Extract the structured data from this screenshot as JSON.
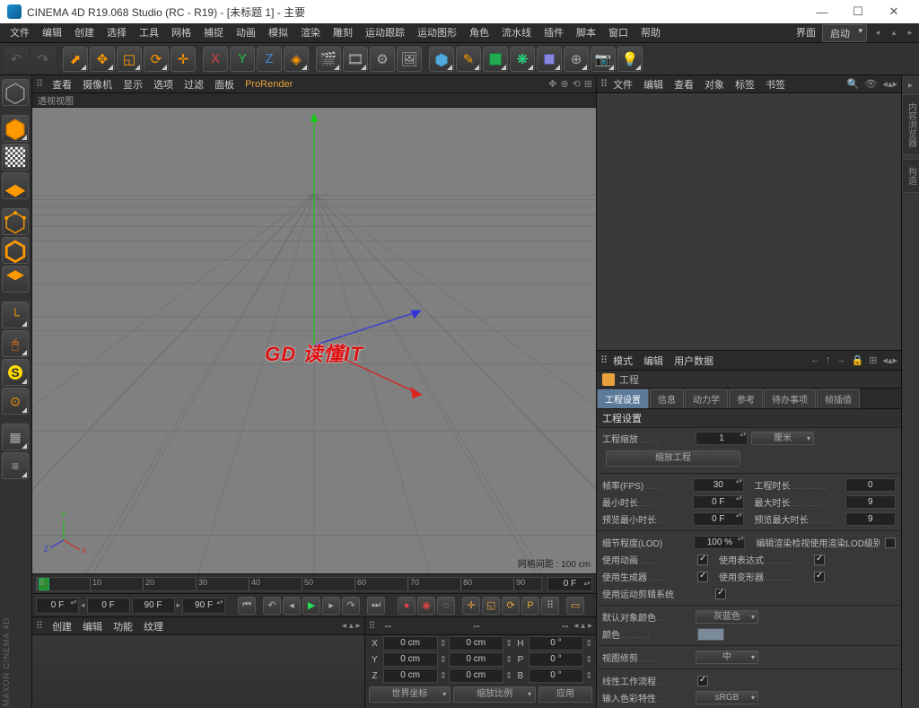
{
  "title": "CINEMA 4D R19.068 Studio (RC - R19) - [未标题 1] - 主要",
  "mainmenu": [
    "文件",
    "编辑",
    "创建",
    "选择",
    "工具",
    "网格",
    "捕捉",
    "动画",
    "模拟",
    "渲染",
    "雕刻",
    "运动跟踪",
    "运动图形",
    "角色",
    "流水线",
    "插件",
    "脚本",
    "窗口",
    "帮助"
  ],
  "layout_label": "界面",
  "layout_value": "启动",
  "vp_menu": [
    "查看",
    "摄像机",
    "显示",
    "选项",
    "过滤",
    "面板"
  ],
  "vp_prorender": "ProRender",
  "vp_subtitle": "透视视图",
  "vp_grid_label": "网格间距 : 100 cm",
  "axis": {
    "x": "X",
    "y": "Y",
    "z": "Z"
  },
  "watermark": "GD 读懂IT",
  "timeline": {
    "ticks": [
      "0",
      "10",
      "20",
      "30",
      "40",
      "50",
      "60",
      "70",
      "80",
      "90"
    ],
    "end": "0 F"
  },
  "playback": {
    "cur": "0 F",
    "start": "0 F",
    "end": "90 F",
    "end2": "90 F"
  },
  "matpanel_menu": [
    "创建",
    "编辑",
    "功能",
    "纹理"
  ],
  "coord_header": [
    "--",
    "--",
    "--"
  ],
  "coord_rows": [
    {
      "axis": "X",
      "p": "0 cm",
      "s": "0 cm",
      "r": "H",
      "rv": "0 °"
    },
    {
      "axis": "Y",
      "p": "0 cm",
      "s": "0 cm",
      "r": "P",
      "rv": "0 °"
    },
    {
      "axis": "Z",
      "p": "0 cm",
      "s": "0 cm",
      "r": "B",
      "rv": "0 °"
    }
  ],
  "coord_dd1": "世界坐标",
  "coord_dd2": "缩放比例",
  "coord_apply": "应用",
  "om_menu": [
    "文件",
    "编辑",
    "查看",
    "对象",
    "标签",
    "书签"
  ],
  "attr_menu": [
    "模式",
    "编辑",
    "用户数据"
  ],
  "attr_title": "工程",
  "attr_tabs": [
    "工程设置",
    "信息",
    "动力学",
    "参考",
    "待办事项",
    "帧插值"
  ],
  "attr_section": "工程设置",
  "attr": {
    "scale_lbl": "工程缩放",
    "scale_val": "1",
    "scale_unit": "厘米",
    "scale_btn": "缩放工程",
    "fps_lbl": "帧率(FPS)",
    "fps_val": "30",
    "projtime_lbl": "工程时长",
    "projtime_val": "0",
    "minlen_lbl": "最小时长",
    "minlen_val": "0 F",
    "maxlen_lbl": "最大时长",
    "maxlen_val": "9",
    "prevmin_lbl": "预览最小时长",
    "prevmin_val": "0 F",
    "prevmax_lbl": "预览最大时长",
    "prevmax_val": "9",
    "lod_lbl": "细节程度(LOD)",
    "lod_val": "100 %",
    "lodrender_lbl": "编辑渲染检视使用渲染LOD级别",
    "anim_lbl": "使用动画",
    "expr_lbl": "使用表达式",
    "gen_lbl": "使用生成器",
    "deform_lbl": "使用变形器",
    "motion_lbl": "使用运动剪辑系统",
    "defcolor_lbl": "默认对象颜色",
    "defcolor_val": "灰蓝色",
    "color_lbl": "颜色",
    "color_val": "#7a8a99",
    "vclip_lbl": "视图修剪",
    "vclip_val": "中",
    "linear_lbl": "线性工作流程",
    "colorprofile_lbl": "输入色彩特性",
    "colorprofile_val": "sRGB"
  },
  "maxon": "MAXON CINEMA 4D"
}
